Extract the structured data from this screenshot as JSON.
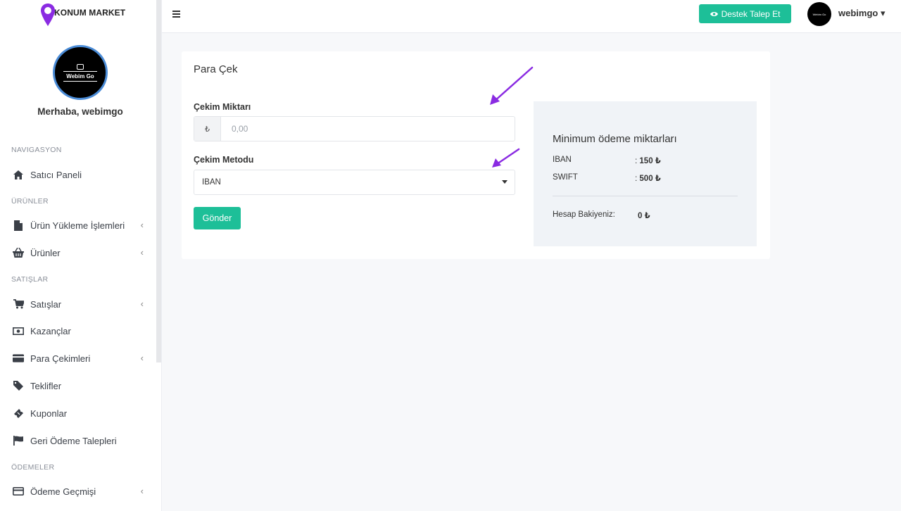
{
  "brand": {
    "name": "KONUM MARKET",
    "accent": "#8a2be2"
  },
  "profile": {
    "avatar_text": "Webim Go",
    "greeting": "Merhaba, webimgo"
  },
  "sidebar": {
    "sections": {
      "navigasyon": "NAVIGASYON",
      "urunler": "ÜRÜNLER",
      "satislar": "SATIŞLAR",
      "odemeler": "ÖDEMELER"
    },
    "items": [
      {
        "label": "Satıcı Paneli",
        "icon": "home-icon"
      },
      {
        "label": "Ürün Yükleme İşlemleri",
        "icon": "file-icon"
      },
      {
        "label": "Ürünler",
        "icon": "basket-icon"
      },
      {
        "label": "Satışlar",
        "icon": "cart-icon"
      },
      {
        "label": "Kazançlar",
        "icon": "money-icon"
      },
      {
        "label": "Para Çekimleri",
        "icon": "credit-card-icon"
      },
      {
        "label": "Teklifler",
        "icon": "tag-icon"
      },
      {
        "label": "Kuponlar",
        "icon": "ticket-icon"
      },
      {
        "label": "Geri Ödeme Talepleri",
        "icon": "flag-icon"
      },
      {
        "label": "Ödeme Geçmişi",
        "icon": "credit-card-icon"
      }
    ]
  },
  "topbar": {
    "support_button": "Destek Talep Et",
    "username": "webimgo",
    "username_caret": "▾"
  },
  "withdraw": {
    "title": "Para Çek",
    "amount_label": "Çekim Miktarı",
    "currency_symbol": "₺",
    "amount_placeholder": "0,00",
    "method_label": "Çekim Metodu",
    "method_selected": "IBAN",
    "submit_label": "Gönder"
  },
  "min_amounts": {
    "title": "Minimum ödeme miktarları",
    "rows": [
      {
        "method": "IBAN",
        "sep": ":",
        "value": "150 ₺"
      },
      {
        "method": "SWIFT",
        "sep": ":",
        "value": "500 ₺"
      }
    ],
    "balance_label": "Hesap Bakiyeniz:",
    "balance_value": "0 ₺"
  },
  "colors": {
    "primary": "#1dbf98",
    "sidebar_text": "#3a3f47",
    "panel_bg": "#f0f3f7"
  }
}
